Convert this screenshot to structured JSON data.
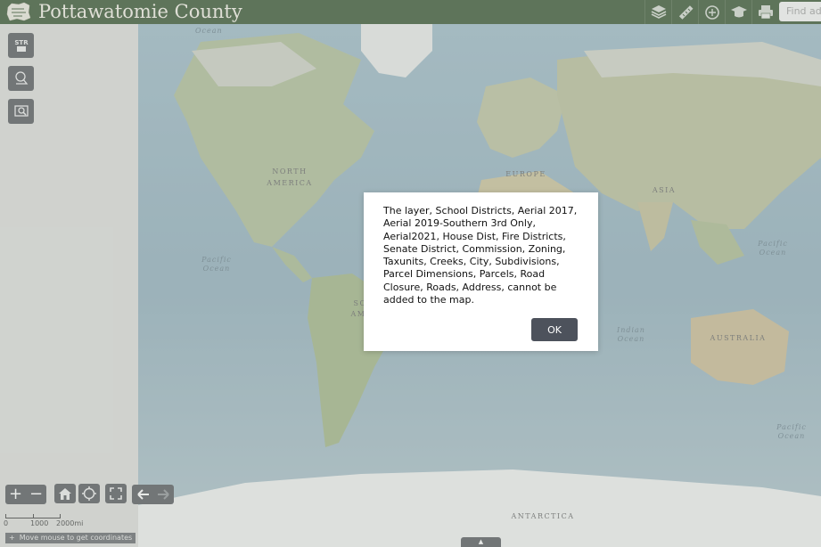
{
  "header": {
    "title": "Pottawatomie County",
    "search_placeholder": "Find add",
    "icons": [
      "layers-icon",
      "measure-icon",
      "draw-icon",
      "education-icon",
      "print-icon"
    ]
  },
  "tools": [
    "str-tool-icon",
    "select-parcel-icon",
    "identify-icon"
  ],
  "map": {
    "labels": {
      "north_america_1": "NORTH",
      "north_america_2": "AMERICA",
      "europe": "EUROPE",
      "asia": "ASIA",
      "australia": "AUSTRALIA",
      "antarctica": "ANTARCTICA",
      "south_america_partial_1": "SO",
      "south_america_partial_2": "AM"
    },
    "oceans": {
      "arctic_top": "Ocean",
      "pacific_left_1": "Pacific",
      "pacific_left_2": "Ocean",
      "pacific_right_1": "Pacific",
      "pacific_right_2": "Ocean",
      "indian_1": "Indian",
      "indian_2": "Ocean",
      "pacific_br_1": "Pacific",
      "pacific_br_2": "Ocean"
    }
  },
  "controls": {
    "zoom_in": "+",
    "zoom_out": "−"
  },
  "scale": {
    "zero": "0",
    "mid": "1000",
    "max": "2000mi"
  },
  "coords": {
    "toggle": "+",
    "text": "Move mouse to get coordinates"
  },
  "dialog": {
    "message": "The layer, School Districts, Aerial 2017, Aerial 2019-Southern 3rd Only, Aerial2021, House Dist, Fire Districts, Senate District, Commission, Zoning, Taxunits, Creeks, City, Subdivisions, Parcel Dimensions, Parcels, Road Closure, Roads, Address, cannot be added to the map.",
    "ok_label": "OK"
  },
  "bottom_tab": "▲"
}
